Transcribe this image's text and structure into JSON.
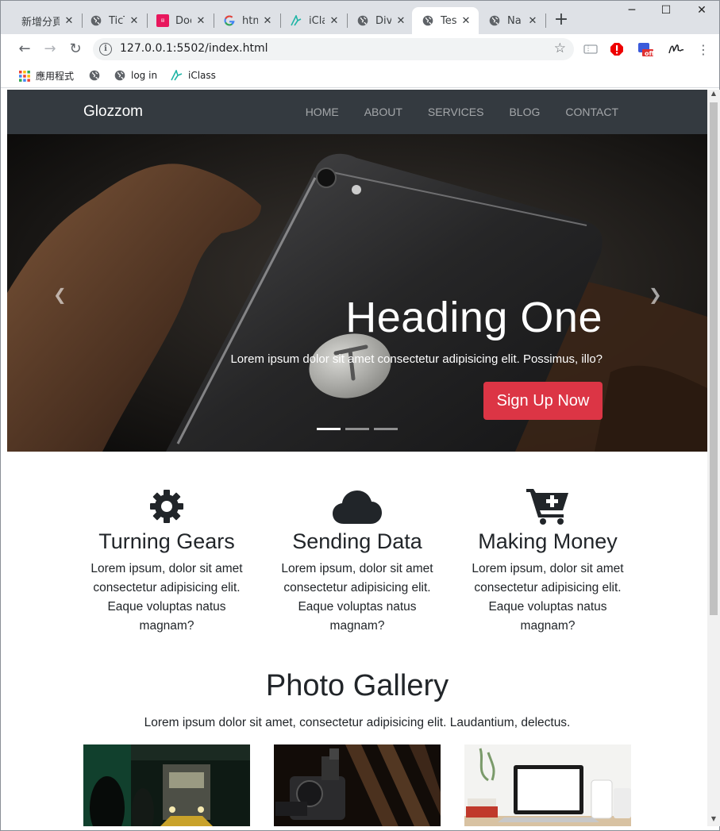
{
  "browser": {
    "tabs": [
      {
        "title": "新增分頁",
        "icon": "blank-page-icon"
      },
      {
        "title": "TicT",
        "icon": "globe-icon"
      },
      {
        "title": "Doc",
        "icon": "docs-icon"
      },
      {
        "title": "htm",
        "icon": "google-icon"
      },
      {
        "title": "iCla",
        "icon": "iclass-icon"
      },
      {
        "title": "Div",
        "icon": "globe-icon"
      },
      {
        "title": "Tes",
        "icon": "globe-icon",
        "active": true
      },
      {
        "title": "Na",
        "icon": "globe-icon"
      }
    ],
    "url": "127.0.0.1:5502/index.html",
    "bookmarks": [
      {
        "label": "應用程式",
        "icon": "apps-grid-icon"
      },
      {
        "label": "",
        "icon": "globe-icon"
      },
      {
        "label": "log in",
        "icon": "globe-icon"
      },
      {
        "label": "iClass",
        "icon": "iclass-icon"
      }
    ],
    "ext_badge": "off"
  },
  "site": {
    "brand": "Glozzom",
    "nav": [
      "HOME",
      "ABOUT",
      "SERVICES",
      "BLOG",
      "CONTACT"
    ],
    "hero": {
      "heading": "Heading One",
      "text": "Lorem ipsum dolor sit amet consectetur adipisicing elit. Possimus, illo?",
      "button": "Sign Up Now",
      "slides": 3,
      "active_slide": 1
    },
    "features": [
      {
        "icon": "gear-icon",
        "title": "Turning Gears",
        "lines": [
          "Lorem ipsum, dolor sit amet",
          "consectetur adipisicing elit.",
          "Eaque voluptas natus",
          "magnam?"
        ]
      },
      {
        "icon": "cloud-icon",
        "title": "Sending Data",
        "lines": [
          "Lorem ipsum, dolor sit amet",
          "consectetur adipisicing elit.",
          "Eaque voluptas natus",
          "magnam?"
        ]
      },
      {
        "icon": "cart-plus-icon",
        "title": "Making Money",
        "lines": [
          "Lorem ipsum, dolor sit amet",
          "consectetur adipisicing elit.",
          "Eaque voluptas natus",
          "magnam?"
        ]
      }
    ],
    "gallery": {
      "title": "Photo Gallery",
      "subtitle": "Lorem ipsum dolor sit amet, consectetur adipisicing elit. Laudantium, delectus."
    }
  },
  "colors": {
    "navbar": "#343a40",
    "accent": "#dc3545"
  }
}
